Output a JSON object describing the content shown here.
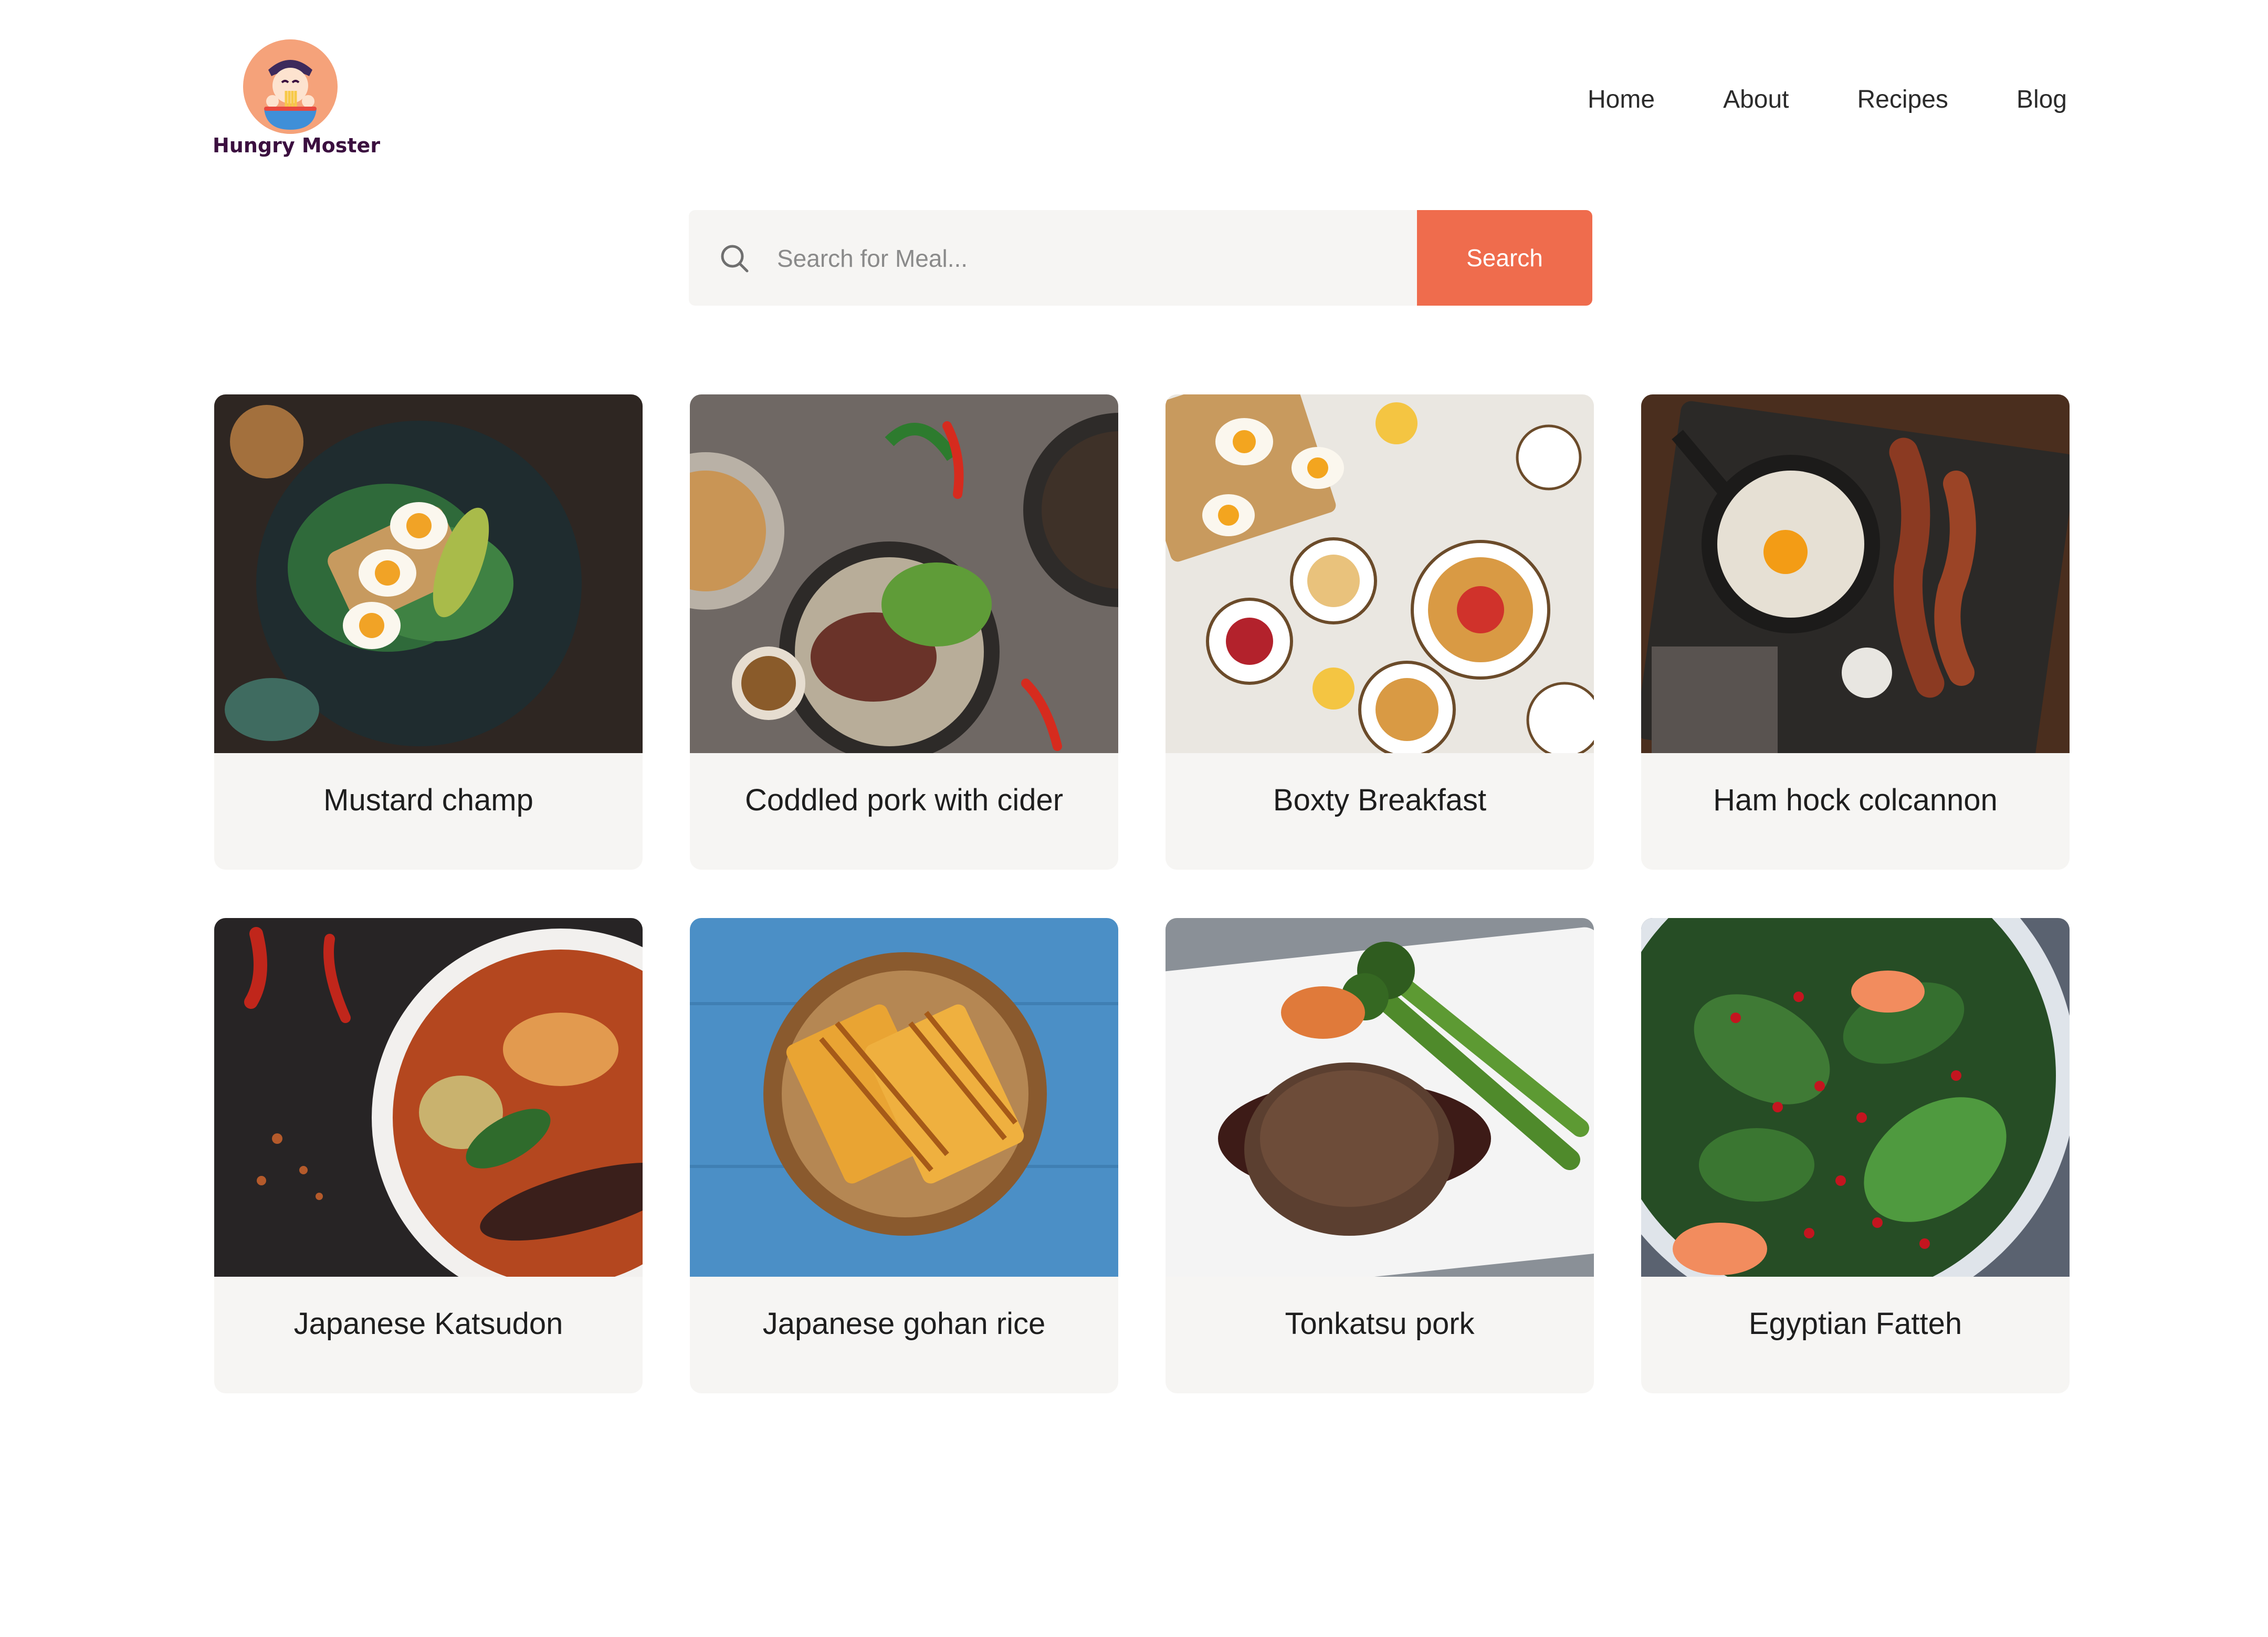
{
  "header": {
    "brand_name": "Hungry Moster",
    "nav": [
      {
        "label": "Home"
      },
      {
        "label": "About"
      },
      {
        "label": "Recipes"
      },
      {
        "label": "Blog"
      }
    ]
  },
  "search": {
    "placeholder": "Search for Meal...",
    "value": "",
    "button_label": "Search",
    "icon": "search-icon"
  },
  "colors": {
    "accent": "#ef6c4d",
    "card_background": "#f6f5f3",
    "brand_text": "#3b0f3f"
  },
  "meals": [
    {
      "title": "Mustard champ",
      "image": "egg-avocado-toast-photo"
    },
    {
      "title": "Coddled pork with cider",
      "image": "beef-salad-bowls-photo"
    },
    {
      "title": "Boxty Breakfast",
      "image": "waffles-brunch-table-photo"
    },
    {
      "title": "Ham hock colcannon",
      "image": "fried-egg-bacon-skillet-photo"
    },
    {
      "title": "Japanese Katsudon",
      "image": "curry-soup-bowl-photo"
    },
    {
      "title": "Japanese gohan rice",
      "image": "grilled-sandwich-plate-photo"
    },
    {
      "title": "Tonkatsu pork",
      "image": "steak-broccolini-plate-photo"
    },
    {
      "title": "Egyptian Fatteh",
      "image": "pomegranate-spinach-salad-photo"
    }
  ]
}
